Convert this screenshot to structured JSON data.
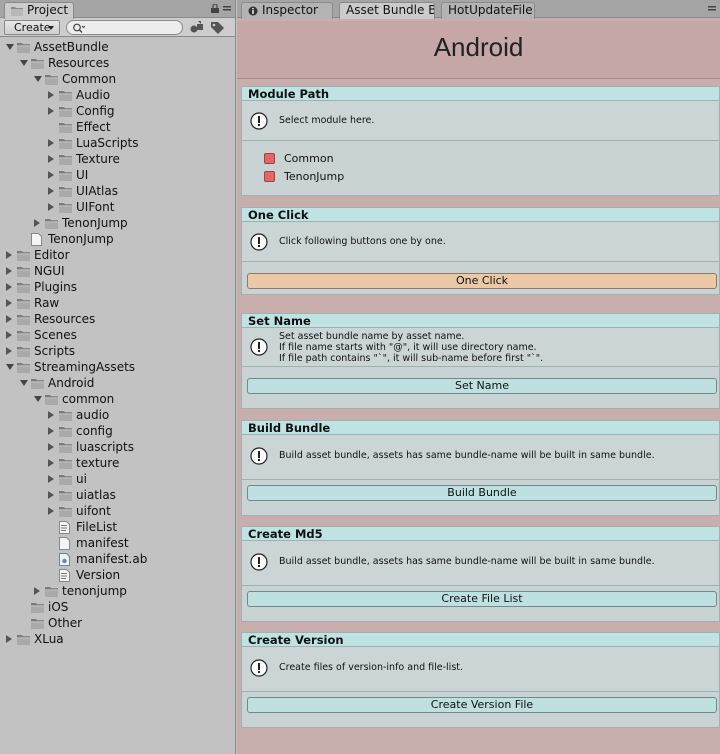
{
  "project_panel": {
    "tab_label": "Project",
    "create_label": "Create",
    "search_placeholder": "",
    "tree": [
      {
        "label": "AssetBundle",
        "depth": 0,
        "expander": "down",
        "icon": "folder-icon"
      },
      {
        "label": "Resources",
        "depth": 1,
        "expander": "down",
        "icon": "folder-icon"
      },
      {
        "label": "Common",
        "depth": 2,
        "expander": "down",
        "icon": "folder-icon"
      },
      {
        "label": "Audio",
        "depth": 3,
        "expander": "right",
        "icon": "folder-icon"
      },
      {
        "label": "Config",
        "depth": 3,
        "expander": "right",
        "icon": "folder-icon"
      },
      {
        "label": "Effect",
        "depth": 3,
        "expander": "none",
        "icon": "folder-icon"
      },
      {
        "label": "LuaScripts",
        "depth": 3,
        "expander": "right",
        "icon": "folder-icon"
      },
      {
        "label": "Texture",
        "depth": 3,
        "expander": "right",
        "icon": "folder-icon"
      },
      {
        "label": "UI",
        "depth": 3,
        "expander": "right",
        "icon": "folder-icon"
      },
      {
        "label": "UIAtlas",
        "depth": 3,
        "expander": "right",
        "icon": "folder-icon"
      },
      {
        "label": "UIFont",
        "depth": 3,
        "expander": "right",
        "icon": "folder-icon"
      },
      {
        "label": "TenonJump",
        "depth": 2,
        "expander": "right",
        "icon": "folder-icon"
      },
      {
        "label": "TenonJump",
        "depth": 1,
        "expander": "none",
        "icon": "file-icon"
      },
      {
        "label": "Editor",
        "depth": 0,
        "expander": "right",
        "icon": "folder-icon"
      },
      {
        "label": "NGUI",
        "depth": 0,
        "expander": "right",
        "icon": "folder-icon"
      },
      {
        "label": "Plugins",
        "depth": 0,
        "expander": "right",
        "icon": "folder-icon"
      },
      {
        "label": "Raw",
        "depth": 0,
        "expander": "right",
        "icon": "folder-icon"
      },
      {
        "label": "Resources",
        "depth": 0,
        "expander": "right",
        "icon": "folder-icon"
      },
      {
        "label": "Scenes",
        "depth": 0,
        "expander": "right",
        "icon": "folder-icon"
      },
      {
        "label": "Scripts",
        "depth": 0,
        "expander": "right",
        "icon": "folder-icon"
      },
      {
        "label": "StreamingAssets",
        "depth": 0,
        "expander": "down",
        "icon": "folder-icon"
      },
      {
        "label": "Android",
        "depth": 1,
        "expander": "down",
        "icon": "folder-icon"
      },
      {
        "label": "common",
        "depth": 2,
        "expander": "down",
        "icon": "folder-icon"
      },
      {
        "label": "audio",
        "depth": 3,
        "expander": "right",
        "icon": "folder-icon"
      },
      {
        "label": "config",
        "depth": 3,
        "expander": "right",
        "icon": "folder-icon"
      },
      {
        "label": "luascripts",
        "depth": 3,
        "expander": "right",
        "icon": "folder-icon"
      },
      {
        "label": "texture",
        "depth": 3,
        "expander": "right",
        "icon": "folder-icon"
      },
      {
        "label": "ui",
        "depth": 3,
        "expander": "right",
        "icon": "folder-icon"
      },
      {
        "label": "uiatlas",
        "depth": 3,
        "expander": "right",
        "icon": "folder-icon"
      },
      {
        "label": "uifont",
        "depth": 3,
        "expander": "right",
        "icon": "folder-icon"
      },
      {
        "label": "FileList",
        "depth": 3,
        "expander": "none",
        "icon": "text-file-icon"
      },
      {
        "label": "manifest",
        "depth": 3,
        "expander": "none",
        "icon": "file-icon"
      },
      {
        "label": "manifest.ab",
        "depth": 3,
        "expander": "none",
        "icon": "asset-file-icon"
      },
      {
        "label": "Version",
        "depth": 3,
        "expander": "none",
        "icon": "text-file-icon"
      },
      {
        "label": "tenonjump",
        "depth": 2,
        "expander": "right",
        "icon": "folder-icon"
      },
      {
        "label": "iOS",
        "depth": 1,
        "expander": "none",
        "icon": "folder-icon"
      },
      {
        "label": "Other",
        "depth": 1,
        "expander": "none",
        "icon": "folder-icon"
      },
      {
        "label": "XLua",
        "depth": 0,
        "expander": "right",
        "icon": "folder-icon"
      }
    ]
  },
  "inspector": {
    "tabs": [
      "Inspector",
      "Asset Bundle B",
      "HotUpdateFile F"
    ],
    "title": "Android",
    "sections": [
      {
        "key": "module-path",
        "header": "Module Path",
        "help": "Select module here.",
        "modules": [
          "Common",
          "TenonJump"
        ]
      },
      {
        "key": "one-click",
        "header": "One Click",
        "help": "Click following buttons one by one.",
        "button": "One Click"
      },
      {
        "key": "set-name",
        "header": "Set Name",
        "help": "Set asset bundle name by asset name.\nIf file name starts with \"@\", it will use directory name.\nIf file path contains \"`\", it will sub-name before first \"`\".",
        "button": "Set Name"
      },
      {
        "key": "build-bundle",
        "header": "Build Bundle",
        "help": "Build asset bundle, assets has same bundle-name will be built in same bundle.",
        "button": "Build Bundle"
      },
      {
        "key": "create-md5",
        "header": "Create Md5",
        "help": "Build asset bundle, assets has same bundle-name will be built in same bundle.",
        "button": "Create File List"
      },
      {
        "key": "create-version",
        "header": "Create Version",
        "help": "Create files of version-info and file-list.",
        "button": "Create Version File"
      }
    ]
  },
  "colors": {
    "panel_bg": "#c2c2c2",
    "inspector_bg": "#c9aeae",
    "section_header": "#bfe3e3",
    "section_body": "#c9d3d3",
    "orange_button": "#ecc9a6",
    "cyan_button": "#bfe0e0",
    "module_checkbox": "#e46565"
  }
}
